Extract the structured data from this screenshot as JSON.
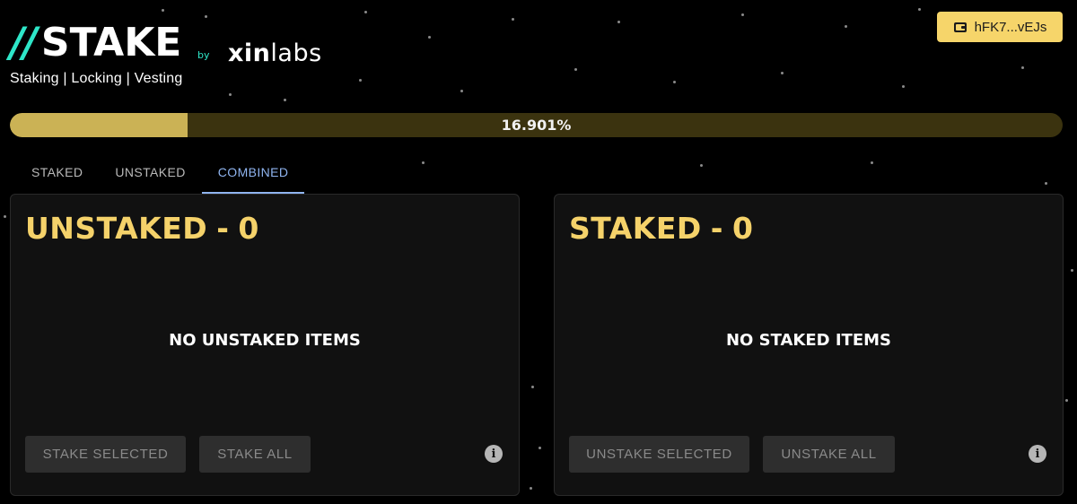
{
  "header": {
    "logo_slashes": "//",
    "logo_word": "STAKE",
    "subtitle": "Staking | Locking | Vesting",
    "by": "by",
    "partner_prefix": "xin",
    "partner_suffix": "labs",
    "wallet_label": "hFK7...vEJs",
    "wallet_icon": "wallet-icon"
  },
  "progress": {
    "label": "16.901%",
    "fraction": 0.16901
  },
  "tabs": [
    {
      "label": "STAKED",
      "active": false
    },
    {
      "label": "UNSTAKED",
      "active": false
    },
    {
      "label": "COMBINED",
      "active": true
    }
  ],
  "panels": {
    "unstaked": {
      "title": "UNSTAKED",
      "separator": "-",
      "count": "0",
      "empty_message": "NO UNSTAKED ITEMS",
      "primary_button": "STAKE SELECTED",
      "secondary_button": "STAKE ALL",
      "info_icon": "info-icon"
    },
    "staked": {
      "title": "STAKED",
      "separator": "-",
      "count": "0",
      "empty_message": "NO STAKED ITEMS",
      "primary_button": "UNSTAKE SELECTED",
      "secondary_button": "UNSTAKE ALL",
      "info_icon": "info-icon"
    }
  },
  "colors": {
    "accent_gold": "#f5d26a",
    "accent_teal": "#2ee6c8",
    "tab_active": "#8fb4ef",
    "background": "#000000"
  }
}
